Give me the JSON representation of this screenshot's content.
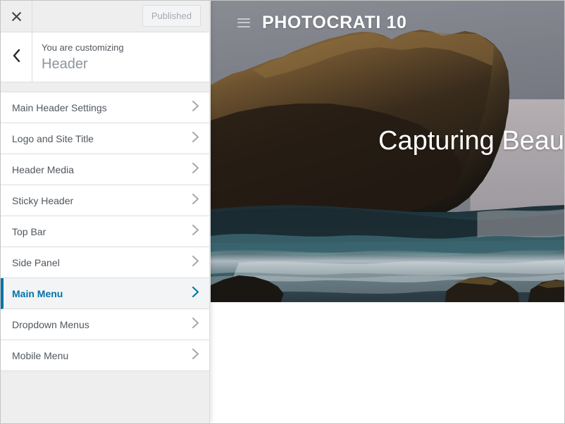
{
  "customizer": {
    "topbar": {
      "close_icon": "close-icon",
      "publish_label": "Published"
    },
    "panel": {
      "back_icon": "chevron-left-icon",
      "eyebrow": "You are customizing",
      "title": "Header"
    },
    "sections": [
      {
        "label": "Main Header Settings",
        "active": false,
        "chevron_icon": "chevron-right-icon"
      },
      {
        "label": "Logo and Site Title",
        "active": false,
        "chevron_icon": "chevron-right-icon"
      },
      {
        "label": "Header Media",
        "active": false,
        "chevron_icon": "chevron-right-icon"
      },
      {
        "label": "Sticky Header",
        "active": false,
        "chevron_icon": "chevron-right-icon"
      },
      {
        "label": "Top Bar",
        "active": false,
        "chevron_icon": "chevron-right-icon"
      },
      {
        "label": "Side Panel",
        "active": false,
        "chevron_icon": "chevron-right-icon"
      },
      {
        "label": "Main Menu",
        "active": true,
        "chevron_icon": "chevron-right-icon"
      },
      {
        "label": "Dropdown Menus",
        "active": false,
        "chevron_icon": "chevron-right-icon"
      },
      {
        "label": "Mobile Menu",
        "active": false,
        "chevron_icon": "chevron-right-icon"
      }
    ]
  },
  "preview": {
    "site_header": {
      "menu_icon": "hamburger-menu-icon",
      "site_title": "PHOTOCRATI 10"
    },
    "hero": {
      "headline": "Capturing Beaut"
    }
  },
  "colors": {
    "accent": "#0073aa",
    "panel_bg": "#eeeeee",
    "row_bg": "#ffffff",
    "text": "#50575e",
    "muted": "#8f959b",
    "border": "#dddddd",
    "disabled_text": "#a7aaad"
  }
}
